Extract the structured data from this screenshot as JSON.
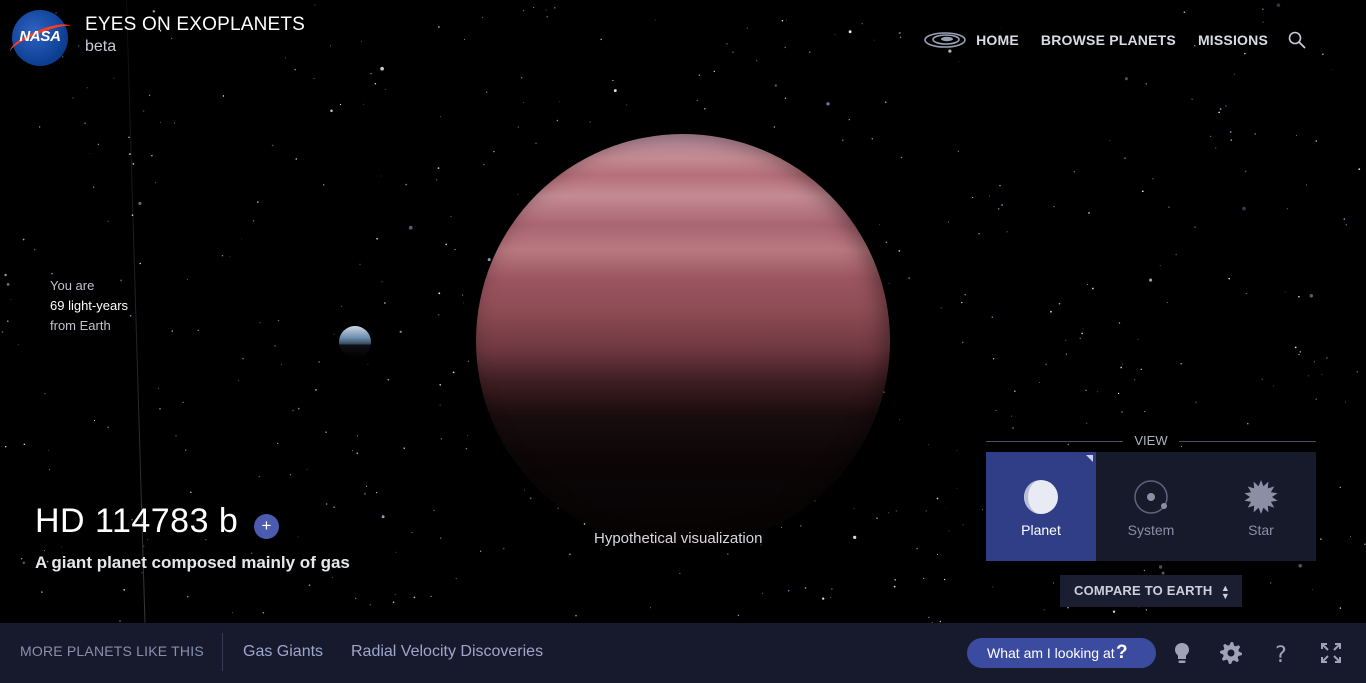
{
  "header": {
    "logo_text": "NASA",
    "app_title": "EYES ON EXOPLANETS",
    "app_subtitle": "beta"
  },
  "nav": {
    "galaxy_icon": "galaxy-icon",
    "items": [
      "HOME",
      "BROWSE PLANETS",
      "MISSIONS"
    ],
    "search_icon": "search-icon"
  },
  "distance": {
    "line1": "You are",
    "value": "69 light-years",
    "line3": "from Earth"
  },
  "scene": {
    "caption": "Hypothetical visualization",
    "planet_colors": [
      "#c58b92",
      "#9b5560",
      "#060303"
    ]
  },
  "planet": {
    "name": "HD 114783 b",
    "add_label": "+",
    "description": "A giant planet composed mainly of gas"
  },
  "view": {
    "label": "VIEW",
    "options": [
      {
        "label": "Planet",
        "icon": "planet-icon",
        "active": true
      },
      {
        "label": "System",
        "icon": "system-icon",
        "active": false
      },
      {
        "label": "Star",
        "icon": "star-icon",
        "active": false
      }
    ],
    "compare_label": "COMPARE TO EARTH",
    "compare_arrows": "▲▼"
  },
  "bottom": {
    "more_label": "MORE PLANETS LIKE THIS",
    "filters": [
      "Gas Giants",
      "Radial Velocity Discoveries"
    ],
    "what_label": "What am I looking at",
    "what_icon": "?",
    "tools": [
      "lightbulb-icon",
      "gear-icon",
      "help-icon",
      "fullscreen-icon"
    ]
  },
  "colors": {
    "accent": "#3b4ba0",
    "bar_bg": "#161a2c",
    "active_view": "#2f3e86"
  }
}
